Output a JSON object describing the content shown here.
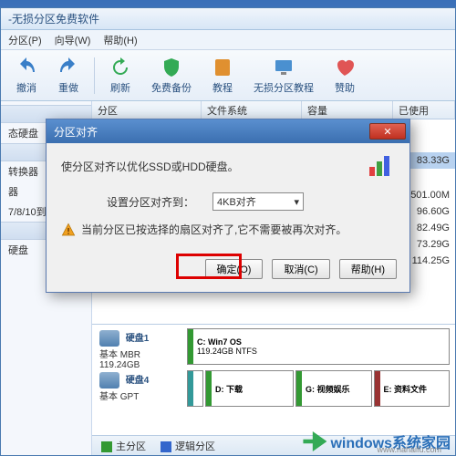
{
  "main": {
    "title": "无损分区免费软件"
  },
  "menu": {
    "partition": "分区(P)",
    "wizard": "向导(W)",
    "help": "帮助(H)"
  },
  "toolbar": {
    "undo": "撤消",
    "redo": "重做",
    "refresh": "刷新",
    "backup": "免费备份",
    "tutorial": "教程",
    "course": "无损分区教程",
    "sponsor": "赞助"
  },
  "list_head": {
    "partition": "分区",
    "fs": "文件系统",
    "cap": "容量",
    "used": "已使用"
  },
  "sidebar": {
    "item1": "态硬盘",
    "item2": "转换器",
    "item3": "器",
    "item4": "7/8/10到…",
    "item5": "硬盘"
  },
  "rows": [
    {
      "used": "83.33G"
    },
    {
      "used": "501.00M"
    },
    {
      "used": "96.60G"
    },
    {
      "used": "82.49G"
    },
    {
      "used": "73.29G"
    },
    {
      "used": "114.25G"
    }
  ],
  "disks": [
    {
      "name": "硬盘1",
      "type": "基本 MBR",
      "size": "119.24GB",
      "parts": [
        {
          "label": "C: Win7 OS",
          "size": "119.24GB NTFS"
        }
      ]
    },
    {
      "name": "硬盘4",
      "type": "基本 GPT",
      "size": "",
      "parts": [
        {
          "label": "D: 下载"
        },
        {
          "label": "G: 视频娱乐"
        },
        {
          "label": "E: 资料文件"
        }
      ]
    }
  ],
  "legend": {
    "primary": "主分区",
    "logical": "逻辑分区"
  },
  "dialog": {
    "title": "分区对齐",
    "msg": "使分区对齐以优化SSD或HDD硬盘。",
    "setting_label": "设置分区对齐到：",
    "combo_value": "4KB对齐",
    "warn": "当前分区已按选择的扇区对齐了,它不需要被再次对齐。",
    "ok": "确定(O)",
    "cancel": "取消(C)",
    "help": "帮助(H)"
  },
  "watermark": {
    "brand": "windows系统家园",
    "url": "www.nahaifu.com"
  }
}
